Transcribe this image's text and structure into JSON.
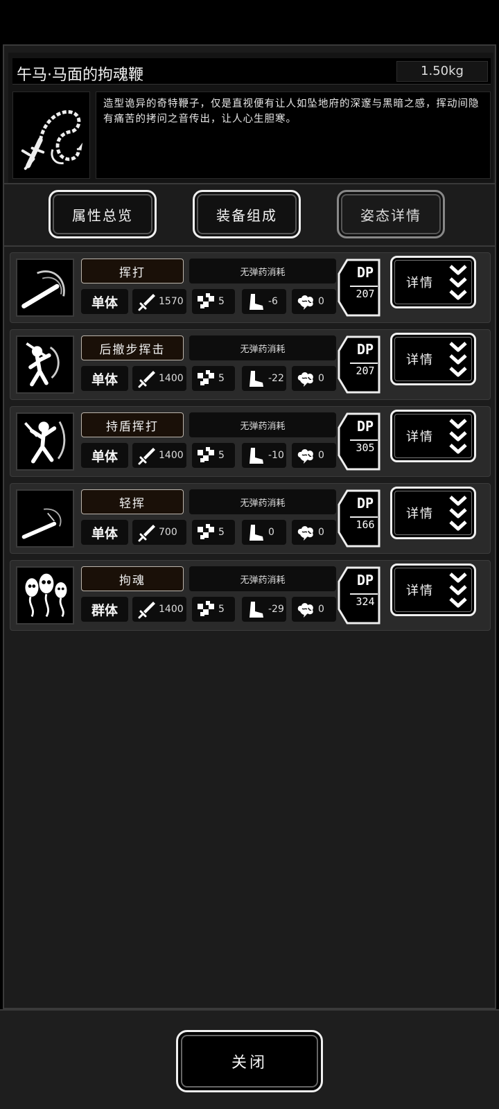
{
  "item": {
    "title": "午马·马面的拘魂鞭",
    "weight": "1.50kg",
    "icon": "whip-icon",
    "description": "造型诡异的奇特鞭子，仅是直视便有让人如坠地府的深邃与黑暗之感，挥动间隐有痛苦的拷问之音传出，让人心生胆寒。"
  },
  "tabs": [
    {
      "label": "属性总览",
      "active": false
    },
    {
      "label": "装备组成",
      "active": false
    },
    {
      "label": "姿态详情",
      "active": true
    }
  ],
  "skills": [
    {
      "name": "挥打",
      "cost": "无弹药消耗",
      "target": "单体",
      "attack": "1570",
      "hit": "5",
      "move": "-6",
      "mind": "0",
      "dp_label": "DP",
      "dp": "207",
      "detail": "详情",
      "icon": "swing-icon"
    },
    {
      "name": "后撤步挥击",
      "cost": "无弹药消耗",
      "target": "单体",
      "attack": "1400",
      "hit": "5",
      "move": "-22",
      "mind": "0",
      "dp_label": "DP",
      "dp": "207",
      "detail": "详情",
      "icon": "backstep-strike-icon"
    },
    {
      "name": "持盾挥打",
      "cost": "无弹药消耗",
      "target": "单体",
      "attack": "1400",
      "hit": "5",
      "move": "-10",
      "mind": "0",
      "dp_label": "DP",
      "dp": "305",
      "detail": "详情",
      "icon": "shield-strike-icon"
    },
    {
      "name": "轻挥",
      "cost": "无弹药消耗",
      "target": "单体",
      "attack": "700",
      "hit": "5",
      "move": "0",
      "mind": "0",
      "dp_label": "DP",
      "dp": "166",
      "detail": "详情",
      "icon": "light-swing-icon"
    },
    {
      "name": "拘魂",
      "cost": "无弹药消耗",
      "target": "群体",
      "attack": "1400",
      "hit": "5",
      "move": "-29",
      "mind": "0",
      "dp_label": "DP",
      "dp": "324",
      "detail": "详情",
      "icon": "soul-capture-icon"
    }
  ],
  "close_label": "关闭",
  "colors": {
    "panel": "#1c1c1c",
    "row": "#2a2a2a",
    "name_bg": "#1a1008",
    "border_light": "#f0f0f0"
  }
}
